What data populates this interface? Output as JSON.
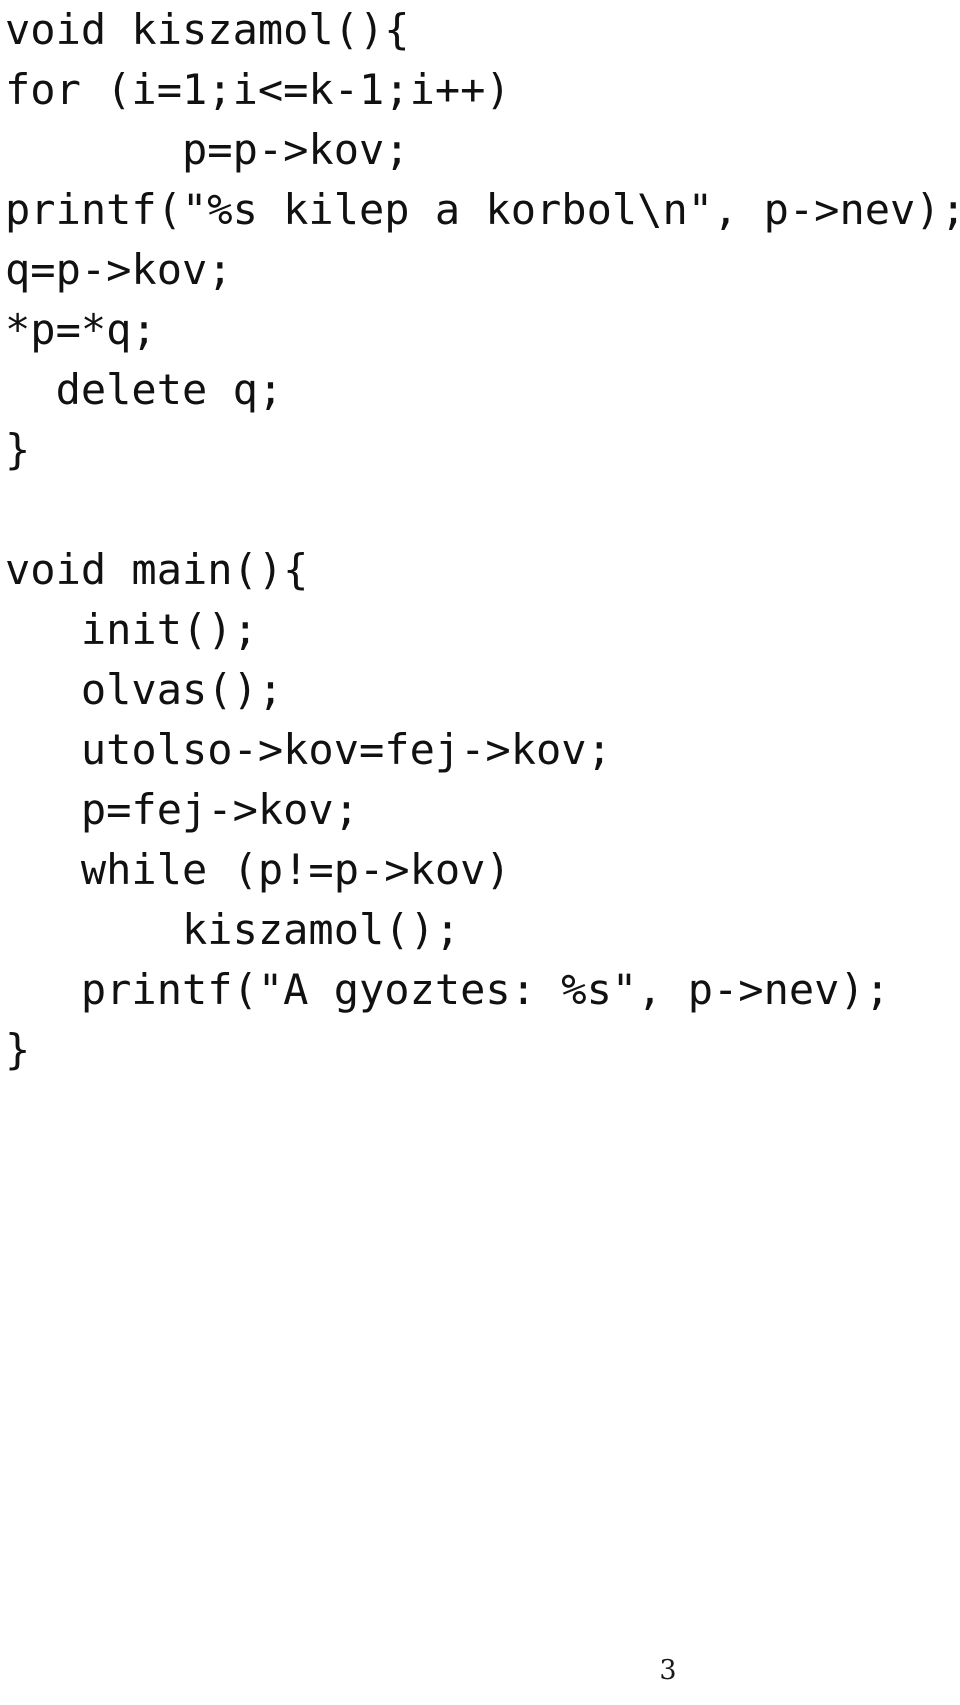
{
  "document": {
    "kind": "code-listing",
    "language": "C/C++",
    "page_number": "3",
    "text_color": "#111111",
    "background_color": "#ffffff"
  },
  "code": {
    "lines": [
      "void kiszamol(){",
      "for (i=1;i<=k-1;i++)",
      "       p=p->kov;",
      "printf(\"%s kilep a korbol\\n\", p->nev);",
      "q=p->kov;",
      "*p=*q;",
      "  delete q;",
      "}",
      "",
      "void main(){",
      "   init();",
      "   olvas();",
      "   utolso->kov=fej->kov;",
      "   p=fej->kov;",
      "   while (p!=p->kov)",
      "       kiszamol();",
      "   printf(\"A gyoztes: %s\", p->nev);",
      "}"
    ]
  }
}
